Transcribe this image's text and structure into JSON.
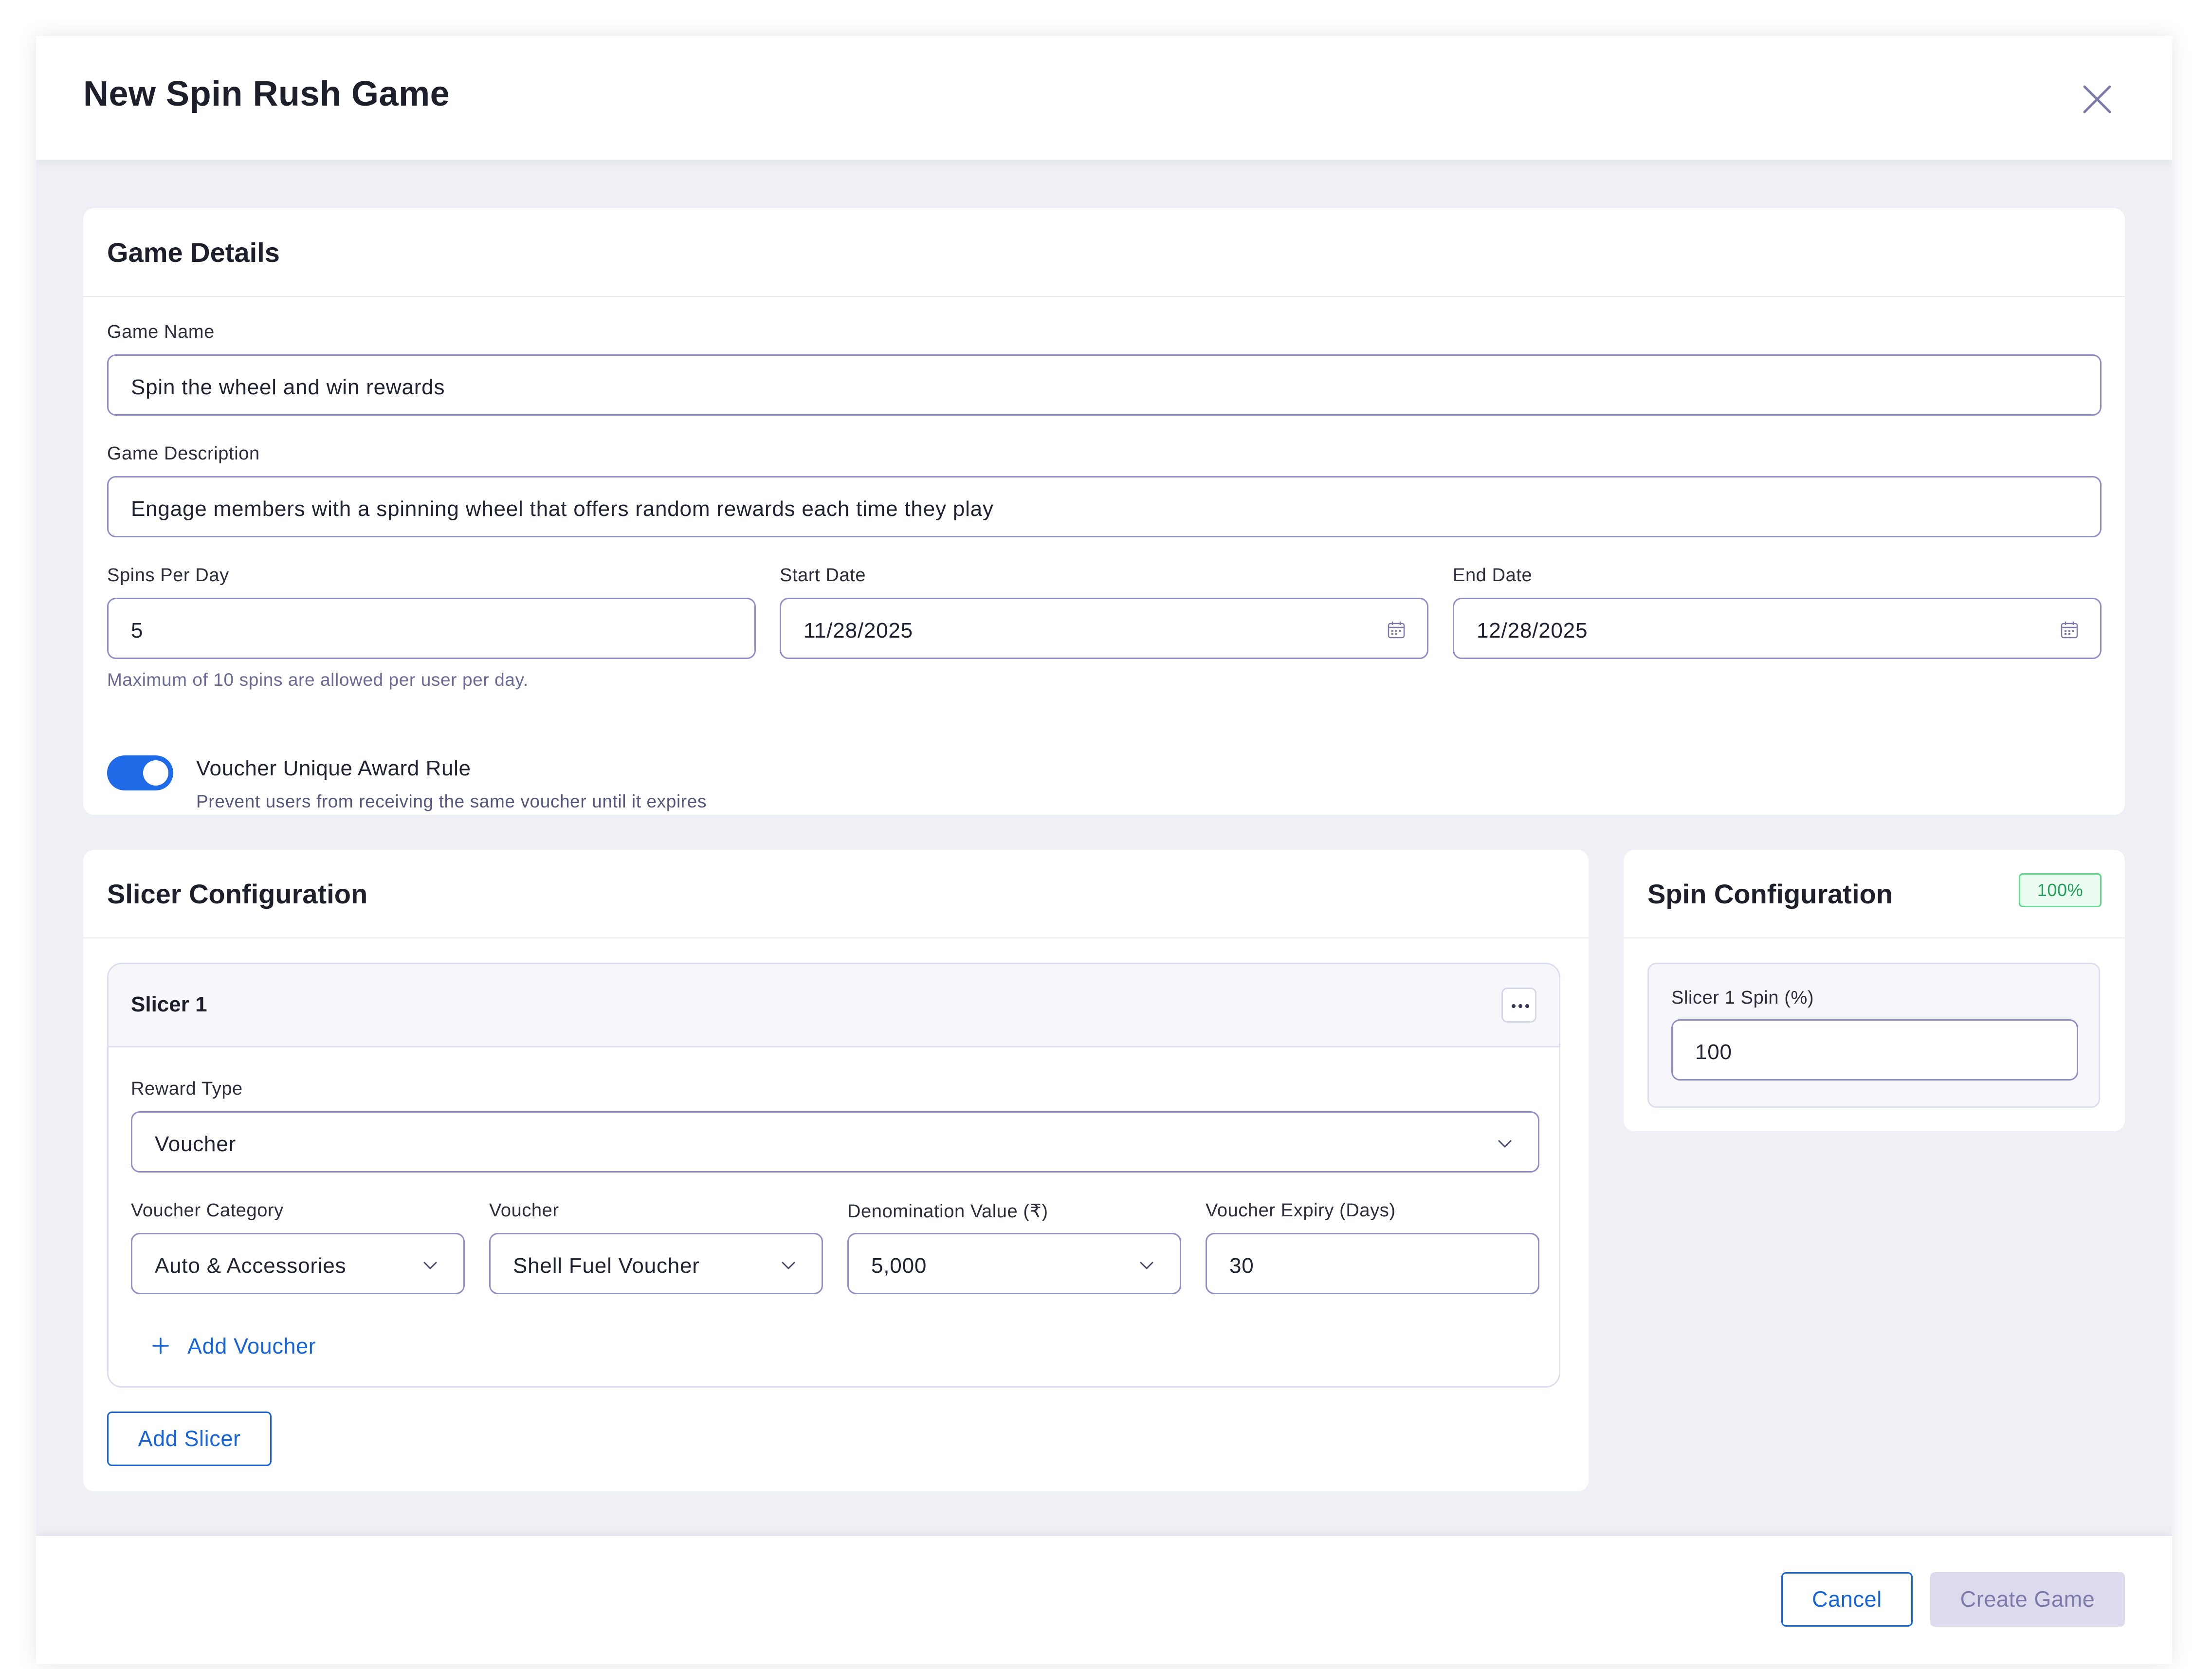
{
  "modal": {
    "title": "New Spin Rush Game",
    "close_icon": "close-icon"
  },
  "game_details": {
    "title": "Game Details",
    "game_name_label": "Game Name",
    "game_name_value": "Spin the wheel and win rewards",
    "game_description_label": "Game Description",
    "game_description_value": "Engage members with a spinning wheel that offers random rewards each time they play",
    "spins_per_day_label": "Spins Per Day",
    "spins_per_day_value": "5",
    "spins_helper": "Maximum of 10 spins are allowed per user per day.",
    "start_date_label": "Start Date",
    "start_date_value": "11/28/2025",
    "end_date_label": "End Date",
    "end_date_value": "12/28/2025",
    "date_icon": "calendar-icon",
    "voucher_rule_title": "Voucher Unique Award Rule",
    "voucher_rule_description": "Prevent users from receiving the same voucher until it expires",
    "voucher_rule_enabled": true
  },
  "slicer_config": {
    "title": "Slicer Configuration",
    "slicers": [
      {
        "title": "Slicer 1",
        "menu_icon": "more-horizontal-icon",
        "reward_type_label": "Reward Type",
        "reward_type_value": "Voucher",
        "voucher_category_label": "Voucher Category",
        "voucher_category_value": "Auto & Accessories",
        "voucher_label": "Voucher",
        "voucher_value": "Shell Fuel Voucher",
        "denomination_label": "Denomination Value (₹)",
        "denomination_value": "5,000",
        "expiry_label": "Voucher Expiry (Days)",
        "expiry_value": "30",
        "add_voucher_label": "Add Voucher"
      }
    ],
    "add_slicer_label": "Add Slicer"
  },
  "spin_config": {
    "title": "Spin Configuration",
    "total_badge": "100%",
    "slicer_1_label": "Slicer 1 Spin (%)",
    "slicer_1_value": "100"
  },
  "footer": {
    "cancel_label": "Cancel",
    "create_label": "Create Game"
  },
  "colors": {
    "accent": "#1763d8",
    "toggle_on": "#1f6ae6",
    "input_border": "#8e8fc7",
    "badge_green": "#1f9f55",
    "backdrop": "#eef0f5",
    "disabled_button": "#dcdbee"
  }
}
